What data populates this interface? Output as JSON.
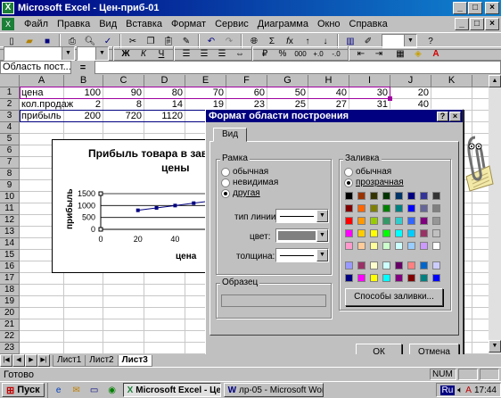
{
  "window": {
    "title": "Microsoft Excel - Цен-приб-01"
  },
  "menu": [
    "Файл",
    "Правка",
    "Вид",
    "Вставка",
    "Формат",
    "Сервис",
    "Диаграмма",
    "Окно",
    "Справка"
  ],
  "toolbar2": {
    "bold": "Ж",
    "italic": "К",
    "underline": "Ч",
    "percent": "%",
    "thousands": "000"
  },
  "formula_bar": {
    "name_box": "Область пост...",
    "fx": "="
  },
  "columns": [
    "A",
    "B",
    "C",
    "D",
    "E",
    "F",
    "G",
    "H",
    "I",
    "J",
    "K",
    "L"
  ],
  "rows": [
    "1",
    "2",
    "3",
    "4",
    "5",
    "6",
    "7",
    "8",
    "9",
    "10",
    "11",
    "12",
    "13",
    "14",
    "15",
    "16",
    "17",
    "18",
    "19",
    "20",
    "21",
    "22",
    "23"
  ],
  "sheet": {
    "row1": {
      "label": "цена",
      "values": [
        "100",
        "90",
        "80",
        "70",
        "60",
        "50",
        "40",
        "30",
        "20"
      ]
    },
    "row2": {
      "label": "кол.продаж",
      "values": [
        "2",
        "8",
        "14",
        "19",
        "23",
        "25",
        "27",
        "31",
        "40"
      ]
    },
    "row3": {
      "label": "прибыль",
      "values": [
        "200",
        "720",
        "1120"
      ]
    }
  },
  "chart": {
    "title": "Прибыль товара в зави... цены",
    "title_line1": "Прибыль товара в зави",
    "title_line2": "цены",
    "ylabel": "прибыль",
    "xlabel": "цена",
    "yticks": [
      "1500",
      "1000",
      "500",
      "0"
    ],
    "xticks": [
      "0",
      "20",
      "40",
      "60"
    ]
  },
  "chart_data": {
    "type": "scatter",
    "x": [
      20,
      30,
      40,
      50,
      60,
      70
    ],
    "y": [
      800,
      900,
      1000,
      1100,
      1200,
      1300
    ],
    "xlim": [
      0,
      70
    ],
    "ylim": [
      0,
      1500
    ],
    "xlabel": "цена",
    "ylabel": "прибыль"
  },
  "dialog": {
    "title": "Формат области построения",
    "help": "?",
    "close": "×",
    "tab": "Вид",
    "frame": {
      "label": "Рамка",
      "opt_normal": "обычная",
      "opt_invisible": "невидимая",
      "opt_other": "другая",
      "linetype_label": "тип линии:",
      "color_label": "цвет:",
      "thickness_label": "толщина:"
    },
    "fill": {
      "label": "Заливка",
      "opt_normal": "обычная",
      "opt_transparent": "прозрачная",
      "palette": [
        "#000000",
        "#993300",
        "#333300",
        "#003300",
        "#003366",
        "#000080",
        "#333399",
        "#333333",
        "#800000",
        "#FF6600",
        "#808000",
        "#008000",
        "#008080",
        "#0000FF",
        "#666699",
        "#808080",
        "#FF0000",
        "#FF9900",
        "#99CC00",
        "#339966",
        "#33CCCC",
        "#3366FF",
        "#800080",
        "#969696",
        "#FF00FF",
        "#FFCC00",
        "#FFFF00",
        "#00FF00",
        "#00FFFF",
        "#00CCFF",
        "#993366",
        "#C0C0C0",
        "#FF99CC",
        "#FFCC99",
        "#FFFF99",
        "#CCFFCC",
        "#CCFFFF",
        "#99CCFF",
        "#CC99FF",
        "#FFFFFF",
        "#9999FF",
        "#993366",
        "#FFFFCC",
        "#CCFFFF",
        "#660066",
        "#FF8080",
        "#0066CC",
        "#CCCCFF",
        "#000080",
        "#FF00FF",
        "#FFFF00",
        "#00FFFF",
        "#800080",
        "#800000",
        "#008080",
        "#0000FF"
      ],
      "fill_methods": "Способы заливки..."
    },
    "sample_label": "Образец",
    "ok": "ОК",
    "cancel": "Отмена"
  },
  "sheet_tabs": [
    "Лист1",
    "Лист2",
    "Лист3"
  ],
  "status": {
    "ready": "Готово",
    "num": "NUM"
  },
  "taskbar": {
    "start": "Пуск",
    "excel": "Microsoft Excel - Цен...",
    "word": "лр-05 - Microsoft Word",
    "lang": "Ru",
    "clock": "17:44"
  }
}
